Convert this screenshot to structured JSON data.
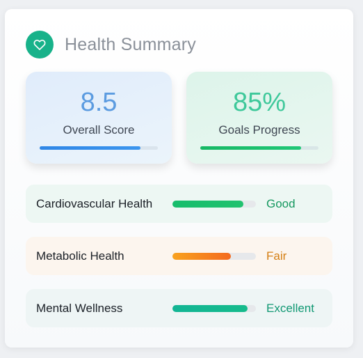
{
  "header": {
    "title": "Health Summary",
    "icon": "heart-icon"
  },
  "metrics": [
    {
      "key": "score",
      "value": "8.5",
      "label": "Overall Score",
      "progress": 0.85,
      "color": "#2f86e6"
    },
    {
      "key": "goals",
      "value": "85%",
      "label": "Goals Progress",
      "progress": 0.85,
      "color": "#16b864"
    }
  ],
  "rows": [
    {
      "key": "cardio",
      "label": "Cardiovascular Health",
      "status": "Good",
      "progress": 0.85,
      "status_color": "#15985f"
    },
    {
      "key": "metabolic",
      "label": "Metabolic Health",
      "status": "Fair",
      "progress": 0.7,
      "status_color": "#d47e12"
    },
    {
      "key": "mental",
      "label": "Mental Wellness",
      "status": "Excellent",
      "progress": 0.9,
      "status_color": "#119873"
    }
  ]
}
